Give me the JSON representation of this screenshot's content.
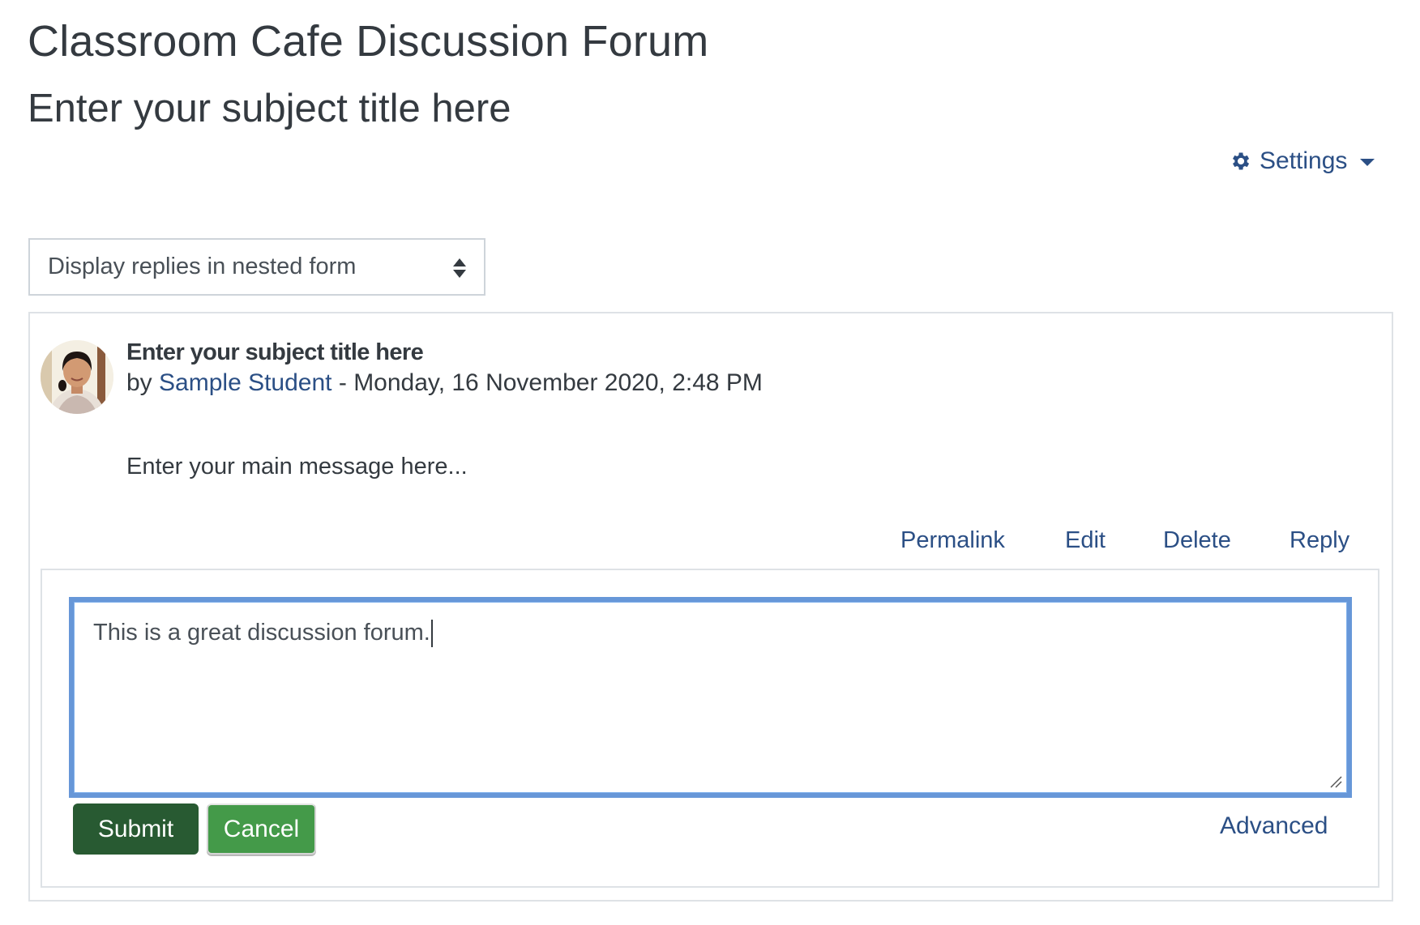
{
  "page": {
    "title": "Classroom Cafe Discussion Forum",
    "subtitle": "Enter your subject title here"
  },
  "settings": {
    "label": "Settings",
    "icon": "gear-icon"
  },
  "display_mode": {
    "selected": "Display replies in nested form"
  },
  "post": {
    "subject": "Enter your subject title here",
    "by_prefix": "by",
    "author": "Sample Student",
    "separator": " - ",
    "datetime": "Monday, 16 November 2020, 2:48 PM",
    "message": "Enter your main message here...",
    "links": {
      "permalink": "Permalink",
      "edit": "Edit",
      "delete": "Delete",
      "reply": "Reply"
    }
  },
  "reply_form": {
    "value": "This is a great discussion forum.",
    "submit_label": "Submit",
    "cancel_label": "Cancel",
    "advanced_label": "Advanced"
  },
  "colors": {
    "link": "#2b4f85",
    "submit": "#285a32",
    "cancel": "#449a49",
    "focus_border": "#6797d8"
  }
}
